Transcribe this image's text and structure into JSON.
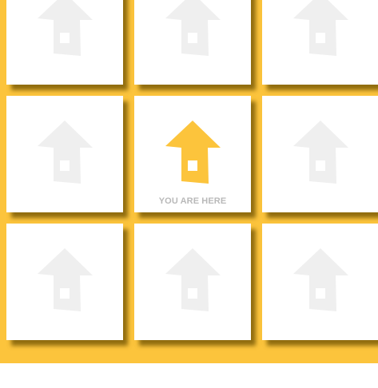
{
  "colors": {
    "board_background": "#fcc43c",
    "tile_background": "#ffffff",
    "inactive_house": "#efefef",
    "current_house": "#fcc43c",
    "caption_text": "#b9b9b9"
  },
  "grid": {
    "rows": 3,
    "columns": 3,
    "current_tile_index": 4,
    "tiles": [
      {
        "icon": "house-icon",
        "current": false
      },
      {
        "icon": "house-icon",
        "current": false
      },
      {
        "icon": "house-icon",
        "current": false
      },
      {
        "icon": "house-icon",
        "current": false
      },
      {
        "icon": "house-icon",
        "current": true
      },
      {
        "icon": "house-icon",
        "current": false
      },
      {
        "icon": "house-icon",
        "current": false
      },
      {
        "icon": "house-icon",
        "current": false
      },
      {
        "icon": "house-icon",
        "current": false
      }
    ]
  },
  "current_location_label": "YOU ARE HERE"
}
